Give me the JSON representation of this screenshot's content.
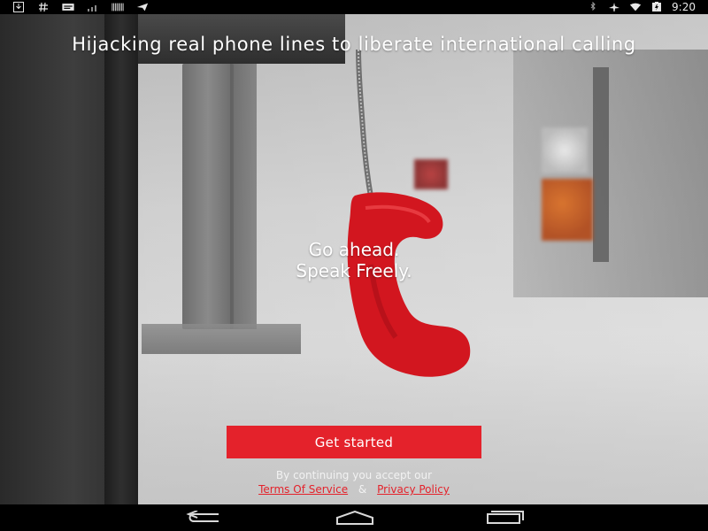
{
  "status_bar": {
    "left_icons": [
      "download-icon",
      "hash-icon",
      "message-icon",
      "signal-small-icon",
      "barcode-icon",
      "paper-plane-icon"
    ],
    "right_icons": [
      "bluetooth-icon",
      "airplane-icon",
      "wifi-icon",
      "battery-icon"
    ],
    "time": "9:20"
  },
  "hero": {
    "headline": "Hijacking real phone lines to liberate international calling",
    "tagline_line1": "Go ahead.",
    "tagline_line2": "Speak Freely."
  },
  "cta": {
    "label": "Get started"
  },
  "legal": {
    "prefix": "By continuing you accept our",
    "terms": "Terms Of Service",
    "and": "&",
    "privacy": "Privacy Policy"
  },
  "colors": {
    "accent_red": "#e4222b"
  },
  "nav_bar": {
    "buttons": [
      "back-icon",
      "home-icon",
      "recent-apps-icon"
    ]
  }
}
